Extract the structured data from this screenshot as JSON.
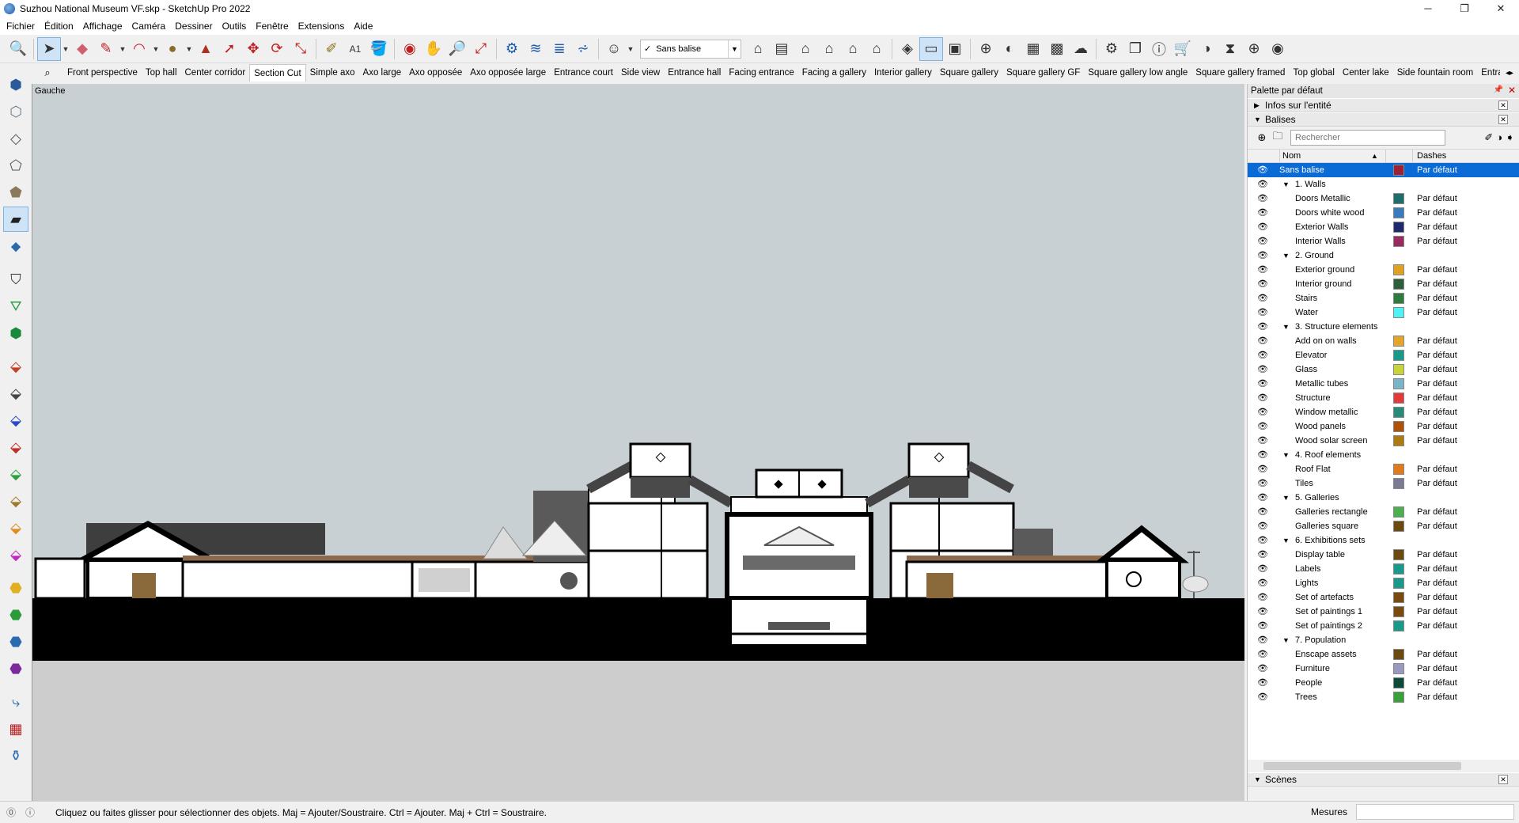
{
  "window": {
    "title": "Suzhou National Museum VF.skp - SketchUp Pro 2022",
    "controls": [
      "─",
      "❐",
      "✕"
    ]
  },
  "menu": [
    "Fichier",
    "Édition",
    "Affichage",
    "Caméra",
    "Dessiner",
    "Outils",
    "Fenêtre",
    "Extensions",
    "Aide"
  ],
  "toolbar": {
    "tag_selector": "Sans balise",
    "tools": [
      "search-icon",
      "select-icon",
      "eraser-icon",
      "pencil-icon",
      "arc-icon",
      "shape-icon",
      "pushpull-icon",
      "followme-icon",
      "move-icon",
      "rotate-icon",
      "scale-icon",
      "tape-icon",
      "text-icon",
      "paint-icon",
      "orbit-icon",
      "pan-icon",
      "zoom-icon",
      "zoom-extents-icon",
      "section-icon"
    ]
  },
  "scenes": {
    "tabs": [
      "Front perspective",
      "Top hall",
      "Center corridor",
      "Section Cut",
      "Simple axo",
      "Axo large",
      "Axo opposée",
      "Axo opposée large",
      "Entrance court",
      "Side view",
      "Entrance hall",
      "Facing entrance",
      "Facing a gallery",
      "Interior gallery",
      "Square gallery",
      "Square gallery GF",
      "Square gallery low angle",
      "Square gallery framed",
      "Top global",
      "Center lake",
      "Side fountain room",
      "Entrance cout side"
    ],
    "active_index": 3
  },
  "viewport": {
    "view_name": "Gauche",
    "sky_color": "#c9d0d4",
    "ground_color": "#cdcdcd"
  },
  "tray": {
    "title": "Palette par défaut",
    "entity_info_label": "Infos sur l'entité",
    "tags_label": "Balises",
    "search_placeholder": "Rechercher",
    "col_name": "Nom",
    "col_dashes": "Dashes",
    "scenes_label": "Scènes"
  },
  "tags": [
    {
      "name": "Sans balise",
      "level": 0,
      "color": "#9b2335",
      "dash": "Par défaut",
      "selected": true
    },
    {
      "name": "1. Walls",
      "level": 1,
      "folder": true
    },
    {
      "name": "Doors Metallic",
      "level": 2,
      "color": "#1e6e70",
      "dash": "Par défaut"
    },
    {
      "name": "Doors white wood",
      "level": 2,
      "color": "#3a7bbf",
      "dash": "Par défaut"
    },
    {
      "name": "Exterior Walls",
      "level": 2,
      "color": "#1f2a6e",
      "dash": "Par défaut"
    },
    {
      "name": "Interior Walls",
      "level": 2,
      "color": "#9a2b5e",
      "dash": "Par défaut"
    },
    {
      "name": "2. Ground",
      "level": 1,
      "folder": true
    },
    {
      "name": "Exterior ground",
      "level": 2,
      "color": "#e0a020",
      "dash": "Par défaut"
    },
    {
      "name": "Interior ground",
      "level": 2,
      "color": "#2e5e3a",
      "dash": "Par défaut"
    },
    {
      "name": "Stairs",
      "level": 2,
      "color": "#2f7a3e",
      "dash": "Par défaut"
    },
    {
      "name": "Water",
      "level": 2,
      "color": "#4ff2f2",
      "dash": "Par défaut"
    },
    {
      "name": "3. Structure elements",
      "level": 1,
      "folder": true
    },
    {
      "name": "Add on on walls",
      "level": 2,
      "color": "#e2a62a",
      "dash": "Par défaut"
    },
    {
      "name": "Elevator",
      "level": 2,
      "color": "#1a9a8a",
      "dash": "Par défaut"
    },
    {
      "name": "Glass",
      "level": 2,
      "color": "#c8d43a",
      "dash": "Par défaut"
    },
    {
      "name": "Metallic tubes",
      "level": 2,
      "color": "#7ab4c8",
      "dash": "Par défaut"
    },
    {
      "name": "Structure",
      "level": 2,
      "color": "#e03a3a",
      "dash": "Par défaut"
    },
    {
      "name": "Window metallic",
      "level": 2,
      "color": "#2a8a7a",
      "dash": "Par défaut"
    },
    {
      "name": "Wood panels",
      "level": 2,
      "color": "#b0520a",
      "dash": "Par défaut"
    },
    {
      "name": "Wood solar screen",
      "level": 2,
      "color": "#b07a12",
      "dash": "Par défaut"
    },
    {
      "name": "4. Roof elements",
      "level": 1,
      "folder": true
    },
    {
      "name": "Roof Flat",
      "level": 2,
      "color": "#e07a1a",
      "dash": "Par défaut"
    },
    {
      "name": "Tiles",
      "level": 2,
      "color": "#7a7a92",
      "dash": "Par défaut"
    },
    {
      "name": "5. Galleries",
      "level": 1,
      "folder": true
    },
    {
      "name": "Galleries rectangle",
      "level": 2,
      "color": "#4caf50",
      "dash": "Par défaut"
    },
    {
      "name": "Galleries square",
      "level": 2,
      "color": "#6b4a12",
      "dash": "Par défaut"
    },
    {
      "name": "6. Exhibitions sets",
      "level": 1,
      "folder": true
    },
    {
      "name": "Display table",
      "level": 2,
      "color": "#6b4a12",
      "dash": "Par défaut"
    },
    {
      "name": "Labels",
      "level": 2,
      "color": "#1a9a8a",
      "dash": "Par défaut"
    },
    {
      "name": "Lights",
      "level": 2,
      "color": "#1a9a8a",
      "dash": "Par défaut"
    },
    {
      "name": "Set of artefacts",
      "level": 2,
      "color": "#7a4a10",
      "dash": "Par défaut"
    },
    {
      "name": "Set of paintings 1",
      "level": 2,
      "color": "#7a4a10",
      "dash": "Par défaut"
    },
    {
      "name": "Set of paintings 2",
      "level": 2,
      "color": "#1a9a8a",
      "dash": "Par défaut"
    },
    {
      "name": "7. Population",
      "level": 1,
      "folder": true
    },
    {
      "name": "Enscape assets",
      "level": 2,
      "color": "#6b4a12",
      "dash": "Par défaut"
    },
    {
      "name": "Furniture",
      "level": 2,
      "color": "#9a9ac0",
      "dash": "Par défaut"
    },
    {
      "name": "People",
      "level": 2,
      "color": "#0e4a3a",
      "dash": "Par défaut"
    },
    {
      "name": "Trees",
      "level": 2,
      "color": "#3aa03a",
      "dash": "Par défaut"
    }
  ],
  "status": {
    "hint": "Cliquez ou faites glisser pour sélectionner des objets. Maj = Ajouter/Soustraire. Ctrl = Ajouter. Maj + Ctrl = Soustraire.",
    "measure_label": "Mesures"
  }
}
